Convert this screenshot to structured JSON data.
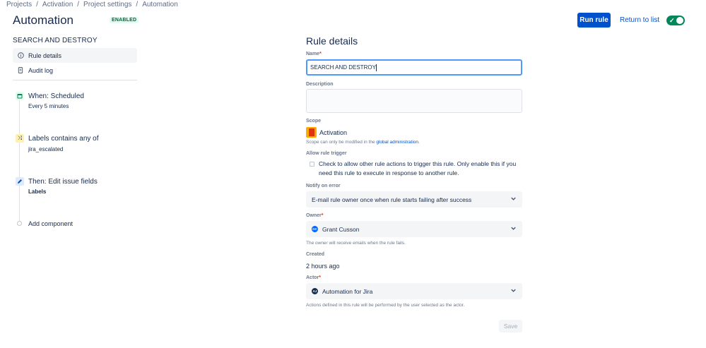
{
  "breadcrumb": [
    "Projects",
    "Activation",
    "Project settings",
    "Automation"
  ],
  "header": {
    "title": "Automation",
    "status": "ENABLED",
    "run_label": "Run rule",
    "return_label": "Return to list",
    "toggle_on": true
  },
  "sidebar": {
    "rule_name": "SEARCH AND DESTROY",
    "nav": [
      {
        "label": "Rule details",
        "icon": "info-icon",
        "active": true
      },
      {
        "label": "Audit log",
        "icon": "document-icon",
        "active": false
      }
    ],
    "flow": [
      {
        "title": "When: Scheduled",
        "subtitle": "Every 5 minutes",
        "icon": "calendar-icon"
      },
      {
        "title": "Labels contains any of",
        "subtitle": "jira_escalated",
        "icon": "shuffle-icon"
      },
      {
        "title": "Then: Edit issue fields",
        "subtitle": "Labels",
        "icon": "pencil-icon"
      }
    ],
    "add_component": "Add component"
  },
  "form": {
    "title": "Rule details",
    "name_label": "Name",
    "name_value": "SEARCH AND DESTROY",
    "description_label": "Description",
    "description_value": "",
    "scope_label": "Scope",
    "scope_value": "Activation",
    "scope_helper_prefix": "Scope can only be modified in the ",
    "scope_helper_link": "global administration",
    "scope_helper_suffix": ".",
    "trigger_label": "Allow rule trigger",
    "trigger_text": "Check to allow other rule actions to trigger this rule. Only enable this if you need this rule to execute in response to another rule.",
    "trigger_checked": false,
    "notify_label": "Notify on error",
    "notify_value": "E-mail rule owner once when rule starts failing after success",
    "owner_label": "Owner",
    "owner_initials": "GC",
    "owner_value": "Grant Cusson",
    "owner_helper": "The owner will receive emails when the rule fails.",
    "created_label": "Created",
    "created_value": "2 hours ago",
    "actor_label": "Actor",
    "actor_initials": "AJ",
    "actor_value": "Automation for Jira",
    "actor_helper": "Actions defined in this rule will be performed by the user selected as the actor.",
    "save_label": "Save"
  },
  "colors": {
    "primary": "#0052cc",
    "enabled": "#00875a",
    "focus": "#4c9aff"
  }
}
